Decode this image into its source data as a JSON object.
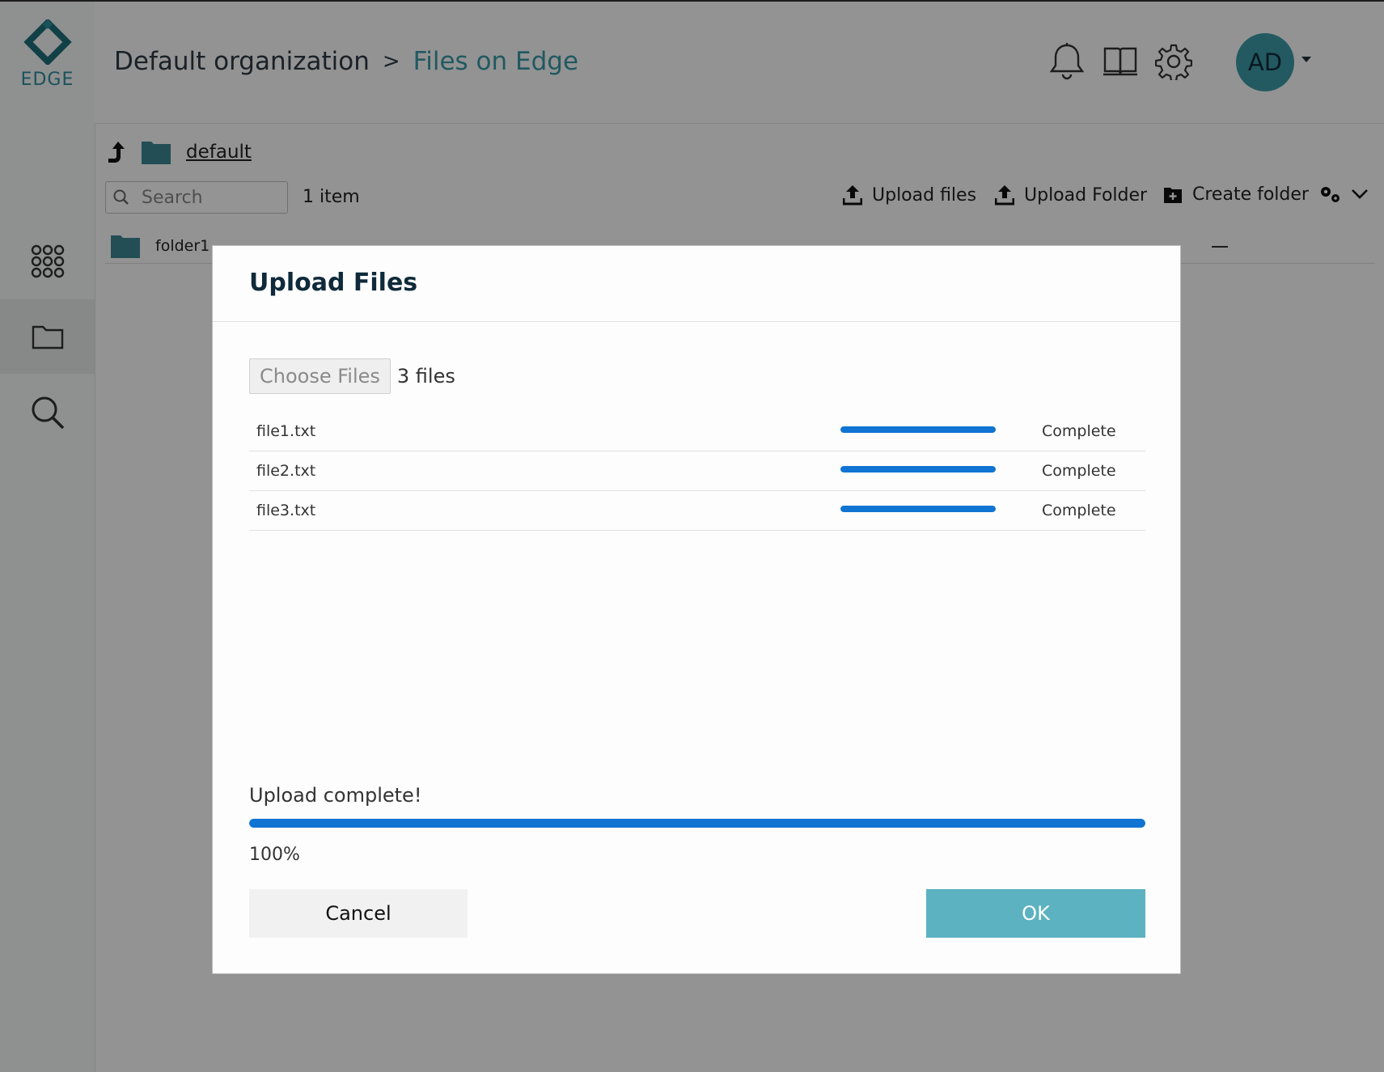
{
  "app": {
    "logo_text": "EDGE"
  },
  "sidebar": {
    "items": [
      {
        "name": "apps",
        "icon": "apps-grid-icon"
      },
      {
        "name": "files",
        "icon": "folder-icon",
        "active": true
      },
      {
        "name": "search",
        "icon": "search-icon"
      }
    ]
  },
  "header": {
    "breadcrumb_org": "Default organization",
    "breadcrumb_sep": ">",
    "breadcrumb_current": "Files on Edge",
    "avatar_initials": "AD"
  },
  "files": {
    "path_folder": "default",
    "search_placeholder": "Search",
    "item_count": "1 item",
    "upload_files_label": "Upload files",
    "upload_folder_label": "Upload Folder",
    "create_folder_label": "Create folder",
    "rows": [
      {
        "name": "folder1",
        "dash": "—"
      }
    ]
  },
  "modal": {
    "title": "Upload Files",
    "choose_label": "Choose Files",
    "file_count": "3 files",
    "uploads": [
      {
        "name": "file1.txt",
        "progress": 1.0,
        "status": "Complete"
      },
      {
        "name": "file2.txt",
        "progress": 1.0,
        "status": "Complete"
      },
      {
        "name": "file3.txt",
        "progress": 1.0,
        "status": "Complete"
      }
    ],
    "message": "Upload complete!",
    "overall_progress": 1.0,
    "percent_text": "100%",
    "cancel_label": "Cancel",
    "ok_label": "OK"
  },
  "colors": {
    "accent": "#3d9ba8",
    "progress": "#0f74d2",
    "ok_button": "#5cb2c1"
  }
}
